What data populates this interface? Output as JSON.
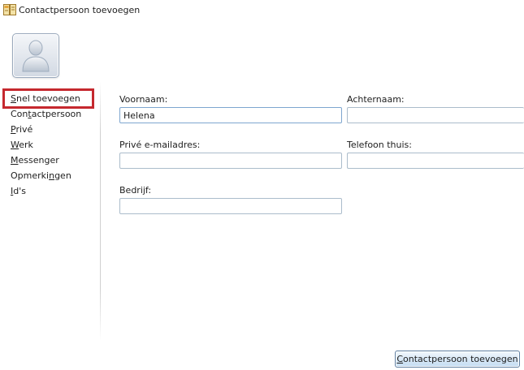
{
  "window": {
    "title": "Contactpersoon toevoegen",
    "icon": "address-book-icon"
  },
  "avatar": {
    "icon": "user-silhouette-icon"
  },
  "nav": {
    "items": [
      {
        "id": "snel-toevoegen",
        "pre": "",
        "key": "S",
        "post": "nel toevoegen",
        "active": true
      },
      {
        "id": "contactpersoon",
        "pre": "Con",
        "key": "t",
        "post": "actpersoon",
        "active": false
      },
      {
        "id": "prive",
        "pre": "",
        "key": "P",
        "post": "rivé",
        "active": false
      },
      {
        "id": "werk",
        "pre": "",
        "key": "W",
        "post": "erk",
        "active": false
      },
      {
        "id": "messenger",
        "pre": "",
        "key": "M",
        "post": "essenger",
        "active": false
      },
      {
        "id": "opmerkingen",
        "pre": "Opmerki",
        "key": "n",
        "post": "gen",
        "active": false
      },
      {
        "id": "ids",
        "pre": "",
        "key": "I",
        "post": "d's",
        "active": false
      }
    ],
    "highlight_color": "#c5282e"
  },
  "form": {
    "first_name": {
      "label": "Voornaam:",
      "value": "Helena"
    },
    "last_name": {
      "label": "Achternaam:",
      "value": ""
    },
    "email": {
      "label": "Privé e-mailadres:",
      "value": ""
    },
    "phone": {
      "label": "Telefoon thuis:",
      "value": ""
    },
    "company": {
      "label": "Bedrijf:",
      "value": ""
    }
  },
  "submit": {
    "pre": "",
    "key": "C",
    "post": "ontactpersoon toevoegen"
  }
}
